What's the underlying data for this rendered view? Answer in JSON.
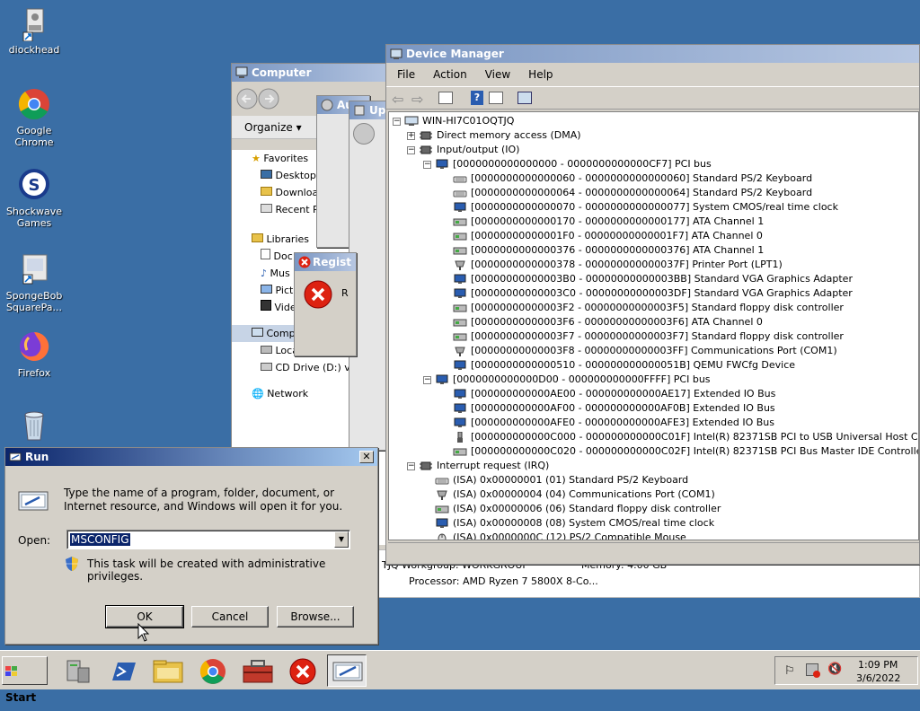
{
  "desktop": {
    "icons": [
      {
        "label": "diockhead",
        "icon": "user-folder-icon"
      },
      {
        "label": "Google Chrome",
        "icon": "chrome-icon"
      },
      {
        "label": "Shockwave Games",
        "icon": "shockwave-icon"
      },
      {
        "label": "SpongeBob SquarePa...",
        "icon": "shortcut-icon"
      },
      {
        "label": "Firefox",
        "icon": "firefox-icon"
      },
      {
        "label": "",
        "icon": "recycle-bin-icon"
      }
    ]
  },
  "computer_window": {
    "title": "Computer",
    "organize_label": "Organize",
    "nav": {
      "favorites": "Favorites",
      "desktop": "Desktop",
      "downloads": "Downloa",
      "recent": "Recent P",
      "libraries": "Libraries",
      "documents": "Doc",
      "music": "Mus",
      "pictures": "Pict",
      "videos": "Vide",
      "computer": "Comp",
      "local_disk": "Local Disk (C:)",
      "cd_drive": "CD Drive (D:) vi",
      "network": "Network"
    },
    "details": {
      "workgroup": "TJQ  Workgroup:  WORKGROUP",
      "memory": "Memory:  4.00 GB",
      "processor": "Processor:  AMD Ryzen 7 5800X 8-Co..."
    }
  },
  "auto_window": {
    "title": "Au"
  },
  "update_window": {
    "title": "Upd"
  },
  "registry_error": {
    "title": "Regist",
    "text": "R"
  },
  "device_manager": {
    "title": "Device Manager",
    "menu": [
      "File",
      "Action",
      "View",
      "Help"
    ],
    "tree": [
      {
        "depth": 0,
        "expander": "−",
        "icon": "computer",
        "text": "WIN-HI7C01OQTJQ"
      },
      {
        "depth": 1,
        "expander": "+",
        "icon": "chip",
        "text": "Direct memory access (DMA)"
      },
      {
        "depth": 1,
        "expander": "−",
        "icon": "chip",
        "text": "Input/output (IO)"
      },
      {
        "depth": 2,
        "expander": "−",
        "icon": "monitor",
        "text": "[0000000000000000 - 0000000000000CF7]  PCI bus"
      },
      {
        "depth": 3,
        "expander": "",
        "icon": "keyboard",
        "text": "[0000000000000060 - 0000000000000060]  Standard PS/2 Keyboard"
      },
      {
        "depth": 3,
        "expander": "",
        "icon": "keyboard",
        "text": "[0000000000000064 - 0000000000000064]  Standard PS/2 Keyboard"
      },
      {
        "depth": 3,
        "expander": "",
        "icon": "monitor",
        "text": "[0000000000000070 - 0000000000000077]  System CMOS/real time clock"
      },
      {
        "depth": 3,
        "expander": "",
        "icon": "disk",
        "text": "[0000000000000170 - 0000000000000177]  ATA Channel 1"
      },
      {
        "depth": 3,
        "expander": "",
        "icon": "disk",
        "text": "[00000000000001F0 - 00000000000001F7]  ATA Channel 0"
      },
      {
        "depth": 3,
        "expander": "",
        "icon": "disk",
        "text": "[0000000000000376 - 0000000000000376]  ATA Channel 1"
      },
      {
        "depth": 3,
        "expander": "",
        "icon": "port",
        "text": "[0000000000000378 - 000000000000037F]  Printer Port (LPT1)"
      },
      {
        "depth": 3,
        "expander": "",
        "icon": "monitor",
        "text": "[00000000000003B0 - 00000000000003BB]  Standard VGA Graphics Adapter"
      },
      {
        "depth": 3,
        "expander": "",
        "icon": "monitor",
        "text": "[00000000000003C0 - 00000000000003DF]  Standard VGA Graphics Adapter"
      },
      {
        "depth": 3,
        "expander": "",
        "icon": "disk",
        "text": "[00000000000003F2 - 00000000000003F5]  Standard floppy disk controller"
      },
      {
        "depth": 3,
        "expander": "",
        "icon": "disk",
        "text": "[00000000000003F6 - 00000000000003F6]  ATA Channel 0"
      },
      {
        "depth": 3,
        "expander": "",
        "icon": "disk",
        "text": "[00000000000003F7 - 00000000000003F7]  Standard floppy disk controller"
      },
      {
        "depth": 3,
        "expander": "",
        "icon": "port",
        "text": "[00000000000003F8 - 00000000000003FF]  Communications Port (COM1)"
      },
      {
        "depth": 3,
        "expander": "",
        "icon": "monitor",
        "text": "[0000000000000510 - 000000000000051B]  QEMU FWCfg Device"
      },
      {
        "depth": 2,
        "expander": "−",
        "icon": "monitor",
        "text": "[0000000000000D00 - 000000000000FFFF]  PCI bus"
      },
      {
        "depth": 3,
        "expander": "",
        "icon": "monitor",
        "text": "[000000000000AE00 - 000000000000AE17]  Extended IO Bus"
      },
      {
        "depth": 3,
        "expander": "",
        "icon": "monitor",
        "text": "[000000000000AF00 - 000000000000AF0B]  Extended IO Bus"
      },
      {
        "depth": 3,
        "expander": "",
        "icon": "monitor",
        "text": "[000000000000AFE0 - 000000000000AFE3]  Extended IO Bus"
      },
      {
        "depth": 3,
        "expander": "",
        "icon": "usb",
        "text": "[000000000000C000 - 000000000000C01F]  Intel(R) 82371SB PCI to USB Universal Host Controller"
      },
      {
        "depth": 3,
        "expander": "",
        "icon": "disk",
        "text": "[000000000000C020 - 000000000000C02F]  Intel(R) 82371SB PCI Bus Master IDE Controller"
      },
      {
        "depth": 1,
        "expander": "−",
        "icon": "chip",
        "text": "Interrupt request (IRQ)"
      },
      {
        "depth": 2,
        "expander": "",
        "icon": "keyboard",
        "text": "(ISA) 0x00000001 (01)    Standard PS/2 Keyboard"
      },
      {
        "depth": 2,
        "expander": "",
        "icon": "port",
        "text": "(ISA) 0x00000004 (04)    Communications Port (COM1)"
      },
      {
        "depth": 2,
        "expander": "",
        "icon": "disk",
        "text": "(ISA) 0x00000006 (06)    Standard floppy disk controller"
      },
      {
        "depth": 2,
        "expander": "",
        "icon": "monitor",
        "text": "(ISA) 0x00000008 (08)    System CMOS/real time clock"
      },
      {
        "depth": 2,
        "expander": "",
        "icon": "mouse",
        "text": "(ISA) 0x0000000C (12)    PS/2 Compatible Mouse"
      }
    ]
  },
  "run_dialog": {
    "title": "Run",
    "description": "Type the name of a program, folder, document, or Internet resource, and Windows will open it for you.",
    "open_label": "Open:",
    "open_value": "MSCONFIG",
    "admin_note": "This task will be created with administrative privileges.",
    "ok_label": "OK",
    "cancel_label": "Cancel",
    "browse_label": "Browse..."
  },
  "taskbar": {
    "start_label": "Start",
    "clock_time": "1:09 PM",
    "clock_date": "3/6/2022",
    "buttons": [
      "server-manager-icon",
      "powershell-icon",
      "explorer-icon",
      "chrome-icon",
      "toolbox-icon",
      "error-icon",
      "run-icon"
    ]
  }
}
